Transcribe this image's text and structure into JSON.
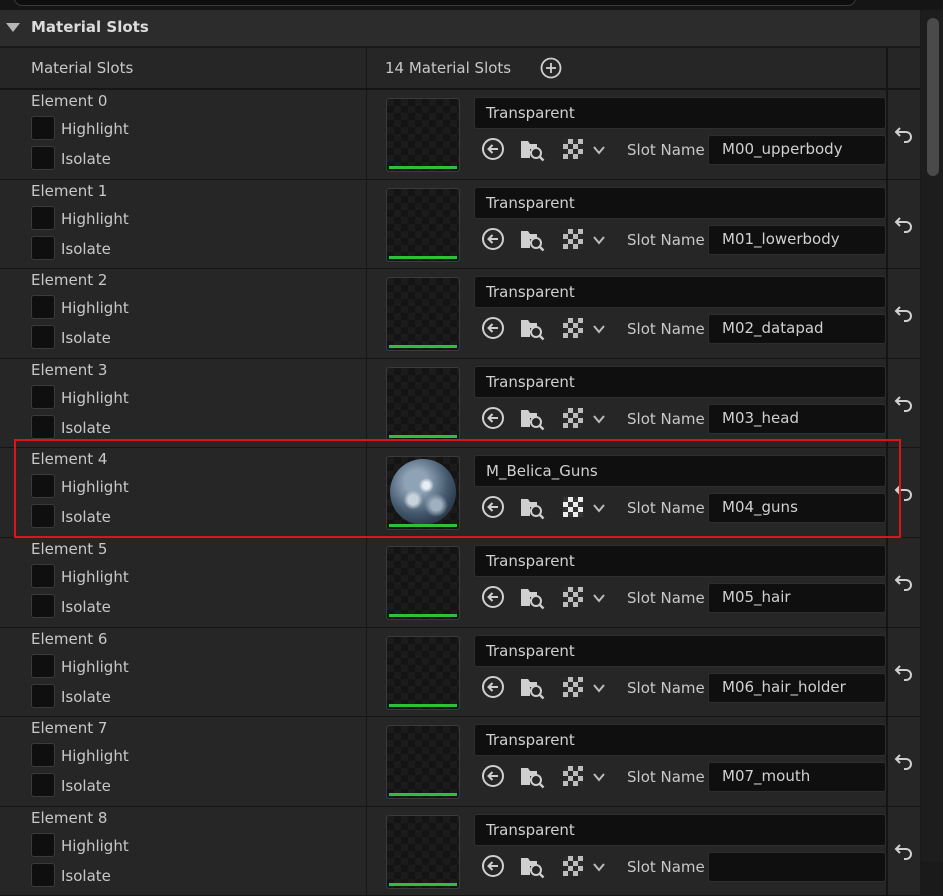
{
  "section": {
    "title": "Material Slots"
  },
  "header": {
    "left_label": "Material Slots",
    "count_label": "14 Material Slots"
  },
  "common": {
    "highlight_label": "Highlight",
    "isolate_label": "Isolate",
    "slot_name_label": "Slot Name"
  },
  "elements": [
    {
      "label": "Element 0",
      "material": "Transparent",
      "slot_name": "M00_upperbody",
      "has_thumbnail": false
    },
    {
      "label": "Element 1",
      "material": "Transparent",
      "slot_name": "M01_lowerbody",
      "has_thumbnail": false
    },
    {
      "label": "Element 2",
      "material": "Transparent",
      "slot_name": "M02_datapad",
      "has_thumbnail": false
    },
    {
      "label": "Element 3",
      "material": "Transparent",
      "slot_name": "M03_head",
      "has_thumbnail": false
    },
    {
      "label": "Element 4",
      "material": "M_Belica_Guns",
      "slot_name": "M04_guns",
      "has_thumbnail": true,
      "selected": true
    },
    {
      "label": "Element 5",
      "material": "Transparent",
      "slot_name": "M05_hair",
      "has_thumbnail": false
    },
    {
      "label": "Element 6",
      "material": "Transparent",
      "slot_name": "M06_hair_holder",
      "has_thumbnail": false
    },
    {
      "label": "Element 7",
      "material": "Transparent",
      "slot_name": "M07_mouth",
      "has_thumbnail": false
    },
    {
      "label": "Element 8",
      "material": "Transparent",
      "slot_name": "",
      "has_thumbnail": false
    }
  ],
  "icons": {
    "expand": "triangle-down-icon",
    "add": "plus-circle-icon",
    "use_selected": "arrow-left-circle-icon",
    "browse": "folder-search-icon",
    "checker": "checkerboard-icon",
    "dropdown": "chevron-down-icon",
    "reset": "reset-arrow-icon"
  },
  "colors": {
    "highlight_outline": "#d9151b",
    "thumbnail_bar": "#2fbf3a"
  }
}
